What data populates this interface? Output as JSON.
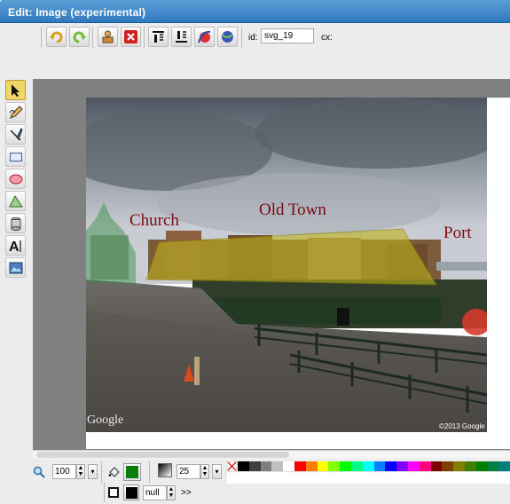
{
  "window": {
    "title": "Edit: Image (experimental)"
  },
  "toolbar": {
    "id_label": "id:",
    "id_value": "svg_19",
    "cx_label": "cx:",
    "buttons": [
      "undo-icon",
      "redo-icon",
      "clone-icon",
      "delete-icon",
      "move-to-top-icon",
      "move-to-bottom-icon",
      "convert-to-path-icon",
      "reorient-path-icon"
    ]
  },
  "left_tools": [
    "select-icon",
    "pencil-icon",
    "line-icon",
    "rectangle-icon",
    "ellipse-icon",
    "path-icon",
    "shapelib-icon",
    "text-icon",
    "image-icon"
  ],
  "canvas": {
    "labels": {
      "church": "Church",
      "old_town": "Old Town",
      "port": "Port"
    },
    "watermark": "Google",
    "copyright": "©2013 Google"
  },
  "bottom": {
    "zoom_value": "100",
    "stroke_width_value": "25",
    "opacity_value": "null",
    "more_label": ">>",
    "fill_color": "#0a7d0a",
    "stroke_color": "#000000"
  },
  "palette": [
    "#000000",
    "#3f3f3f",
    "#7f7f7f",
    "#bfbfbf",
    "#ffffff",
    "#ff0000",
    "#ff7f00",
    "#ffff00",
    "#7fff00",
    "#00ff00",
    "#00ff7f",
    "#00ffff",
    "#007fff",
    "#0000ff",
    "#7f00ff",
    "#ff00ff",
    "#ff007f",
    "#7f0000",
    "#7f3f00",
    "#7f7f00",
    "#3f7f00",
    "#007f00",
    "#007f3f",
    "#007f7f"
  ]
}
